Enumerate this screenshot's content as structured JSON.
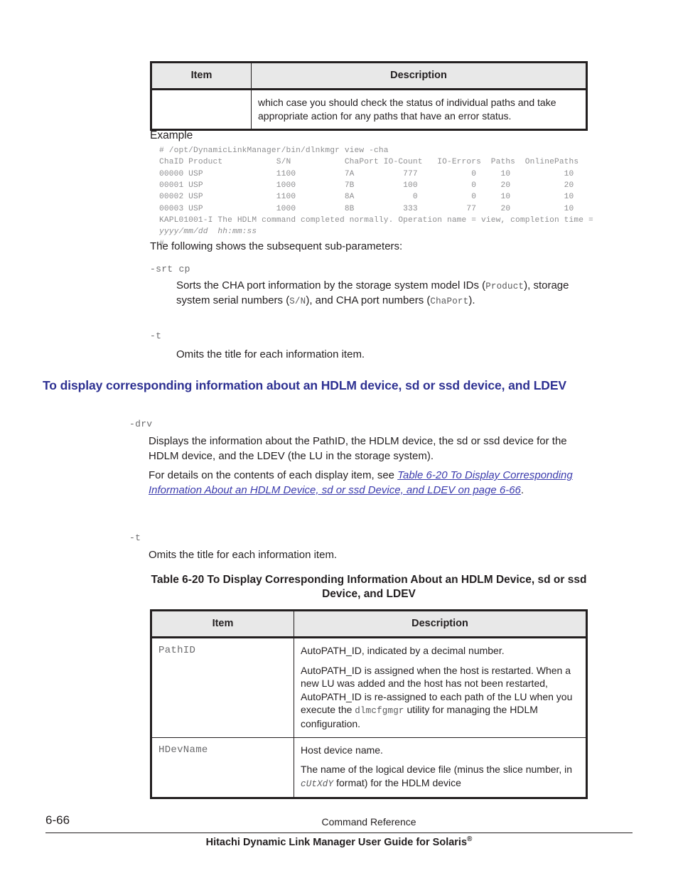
{
  "table_top": {
    "headers": [
      "Item",
      "Description"
    ],
    "rows": [
      {
        "item": "",
        "description": "which case you should check the status of individual paths and take appropriate action for any paths that have an error status."
      }
    ]
  },
  "example": {
    "label": "Example",
    "code_line_1": "# /opt/DynamicLinkManager/bin/dlnkmgr view -cha",
    "code_line_2": "ChaID Product           S/N           ChaPort IO-Count   IO-Errors  Paths  OnlinePaths",
    "code_line_3": "00000 USP               1100          7A          777           0     10           10",
    "code_line_4": "00001 USP               1000          7B          100           0     20           20",
    "code_line_5": "00002 USP               1100          8A            0           0     10           10",
    "code_line_6": "00003 USP               1000          8B          333          77     20           10",
    "code_line_7": "KAPL01001-I The HDLM command completed normally. Operation name = view, completion time =",
    "code_line_8_italic": "yyyy/mm/dd  hh:mm:ss",
    "code_line_9": "#"
  },
  "intro": {
    "following_text": "The following shows the subsequent sub-parameters:"
  },
  "params_view": [
    {
      "term": "-srt cp",
      "def_part_1": "Sorts the CHA port information by the storage system model IDs (",
      "def_mono_1": "Product",
      "def_part_2": "), storage system serial numbers (",
      "def_mono_2": "S/N",
      "def_part_3": "), and CHA port numbers (",
      "def_mono_3": "ChaPort",
      "def_part_4": ")."
    },
    {
      "term": "-t",
      "def_part_1": "Omits the title for each information item."
    }
  ],
  "heading": {
    "text": "To display corresponding information about an HDLM device, sd or ssd device, and LDEV",
    "color": "#2e3192"
  },
  "params_drv": [
    {
      "term": "-drv",
      "para_1": "Displays the information about the PathID, the HDLM device, the sd or ssd device for the HDLM device, and the LDEV (the LU in the storage system).",
      "para_2_prefix": "For details on the contents of each display item, see ",
      "para_2_link": "Table 6-20 To Display Corresponding Information About an HDLM Device, sd or ssd Device, and LDEV on page 6-66",
      "para_2_suffix": ".",
      "link_color": "#3b3bad"
    },
    {
      "term": "-t",
      "para_1": "Omits the title for each information item."
    }
  ],
  "table_caption": "Table 6-20 To Display Corresponding Information About an HDLM Device, sd or ssd Device, and LDEV",
  "table_bottom": {
    "headers": [
      "Item",
      "Description"
    ],
    "rows": [
      {
        "item": "PathID",
        "desc_p1": "AutoPATH_ID, indicated by a decimal number.",
        "desc_p2_a": "AutoPATH_ID is assigned when the host is restarted. When a new LU was added and the host has not been restarted, AutoPATH_ID is re-assigned to each path of the LU when you execute the ",
        "desc_p2_mono": "dlmcfgmgr",
        "desc_p2_b": " utility for managing the HDLM configuration."
      },
      {
        "item": "HDevName",
        "desc_p1": "Host device name.",
        "desc_p2_a": "The name of the logical device file (minus the slice number, in ",
        "desc_p2_mono": "cUtXdY",
        "desc_p2_b": " format) for the HDLM device"
      }
    ]
  },
  "footer": {
    "page_number": "6-66",
    "center_text": "Command Reference",
    "guide_title": "Hitachi Dynamic Link Manager User Guide for Solaris",
    "registered_mark": "®"
  }
}
